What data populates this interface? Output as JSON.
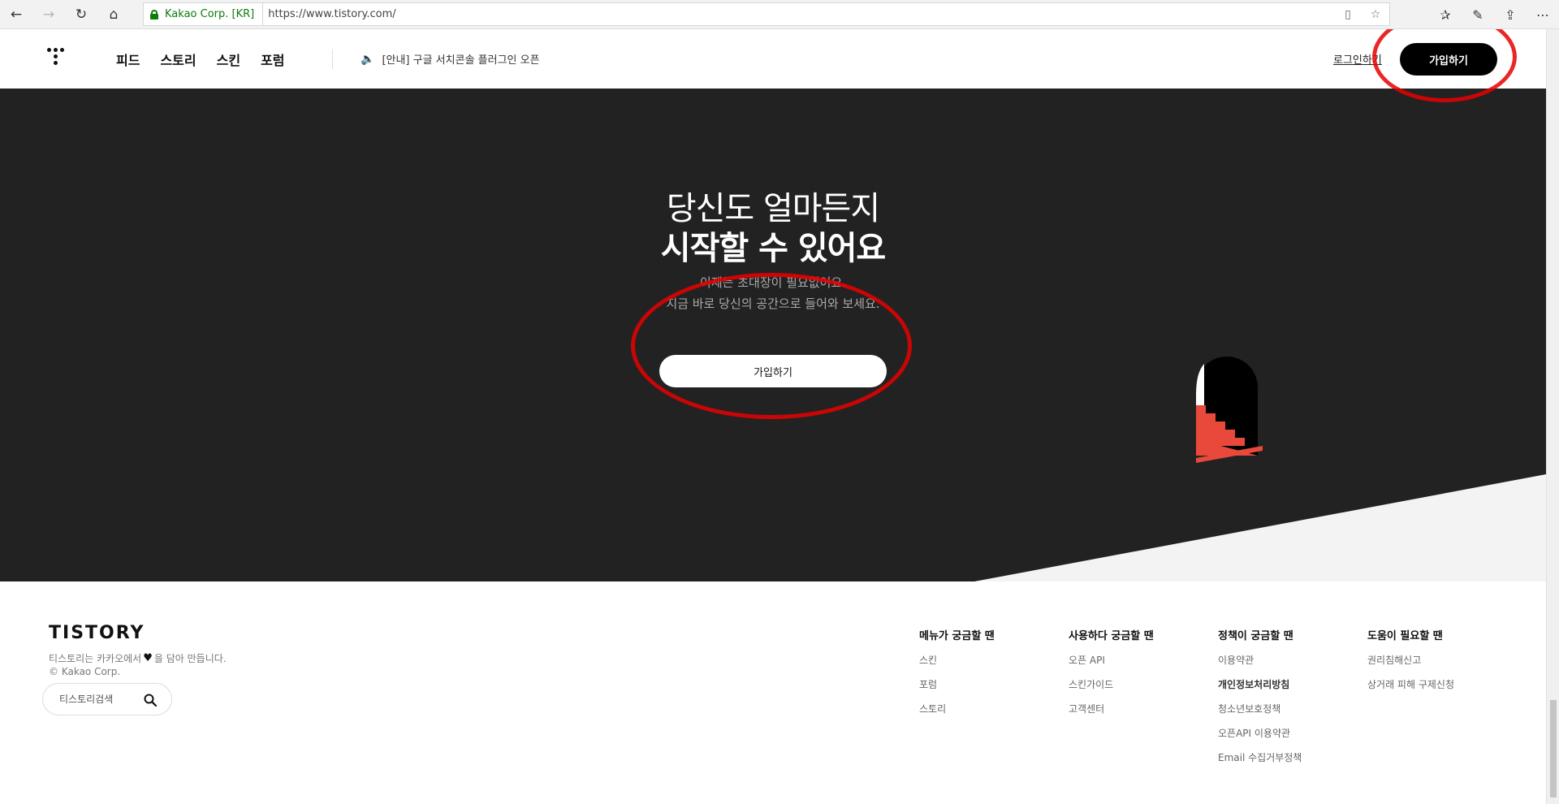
{
  "browser": {
    "cert_label": "Kakao Corp. [KR]",
    "url": "https://www.tistory.com/"
  },
  "header": {
    "nav": [
      "피드",
      "스토리",
      "스킨",
      "포럼"
    ],
    "notice": "[안내] 구글 서치콘솔 플러그인 오픈",
    "login": "로그인하기",
    "signup": "가입하기"
  },
  "hero": {
    "title_light": "당신도 얼마든지",
    "title_bold": "시작할 수 있어요",
    "desc_line1": "이제는 초대장이 필요없어요.",
    "desc_line2": "지금 바로 당신의 공간으로 들어와 보세요.",
    "signup": "가입하기"
  },
  "footer": {
    "logo": "TISTORY",
    "made_before": "티스토리는 카카오에서",
    "made_after": "을 담아 만듭니다.",
    "copyright": "© Kakao Corp.",
    "search_placeholder": "티스토리검색",
    "columns": [
      {
        "title": "메뉴가 궁금할 땐",
        "links": [
          "스킨",
          "포럼",
          "스토리"
        ]
      },
      {
        "title": "사용하다 궁금할 땐",
        "links": [
          "오픈 API",
          "스킨가이드",
          "고객센터"
        ]
      },
      {
        "title": "정책이 궁금할 땐",
        "links": [
          "이용약관",
          "개인정보처리방침",
          "청소년보호정책",
          "오픈API 이용약관",
          "Email 수집거부정책"
        ]
      },
      {
        "title": "도움이 필요할 땐",
        "links": [
          "권리침해신고",
          "상거래 피해 구제신청"
        ]
      }
    ]
  },
  "colors": {
    "hero_bg": "#222222",
    "stairs": "#e8493a",
    "annotation": "#e60000"
  }
}
